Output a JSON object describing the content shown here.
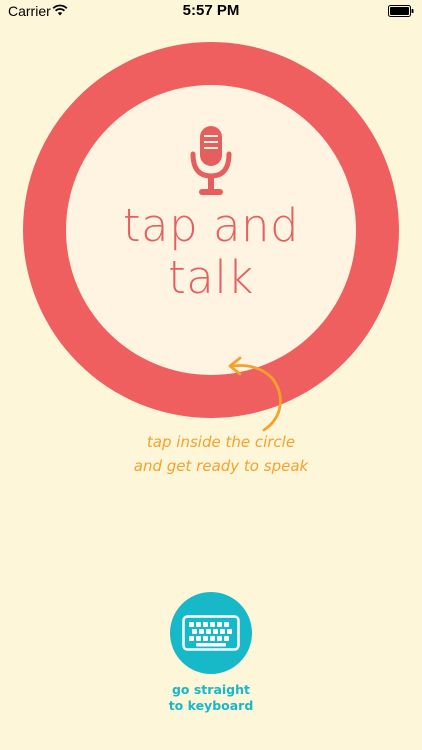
{
  "status_bar": {
    "carrier": "Carrier",
    "time": "5:57 PM"
  },
  "main": {
    "title_line1": "tap and",
    "title_line2": "talk",
    "hint_line1": "tap inside the circle",
    "hint_line2": "and get ready to speak"
  },
  "keyboard": {
    "label_line1": "go straight",
    "label_line2": "to keyboard"
  },
  "colors": {
    "background": "#FEF6D9",
    "circle_ring": "#EF5F5F",
    "circle_inner": "#FEF4E1",
    "hint_text": "#F5A12C",
    "keyboard_accent": "#17B9C8"
  },
  "icons": {
    "mic": "microphone-icon",
    "arrow": "curved-arrow-icon",
    "keyboard": "keyboard-icon",
    "wifi": "wifi-icon",
    "battery": "battery-icon"
  }
}
